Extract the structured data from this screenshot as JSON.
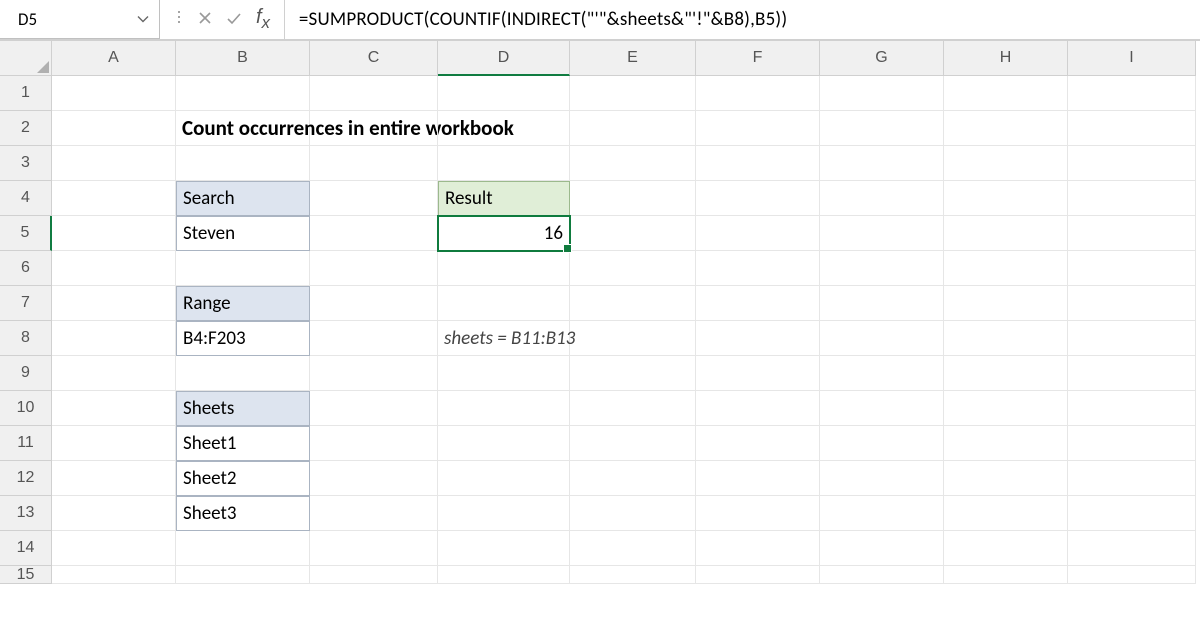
{
  "namebox": {
    "value": "D5"
  },
  "formula": "=SUMPRODUCT(COUNTIF(INDIRECT(\"'\"&sheets&\"'!\"&B8),B5))",
  "columns": [
    "A",
    "B",
    "C",
    "D",
    "E",
    "F",
    "G",
    "H",
    "I"
  ],
  "rows": [
    "1",
    "2",
    "3",
    "4",
    "5",
    "6",
    "7",
    "8",
    "9",
    "10",
    "11",
    "12",
    "13",
    "14",
    "15"
  ],
  "cells": {
    "B2": "Count occurrences in entire workbook",
    "B4": "Search",
    "B5": "Steven",
    "D4": "Result",
    "D5": "16",
    "B7": "Range",
    "B8": "B4:F203",
    "D8": "sheets = B11:B13",
    "B10": "Sheets",
    "B11": "Sheet1",
    "B12": "Sheet2",
    "B13": "Sheet3"
  },
  "active_cell": "D5"
}
